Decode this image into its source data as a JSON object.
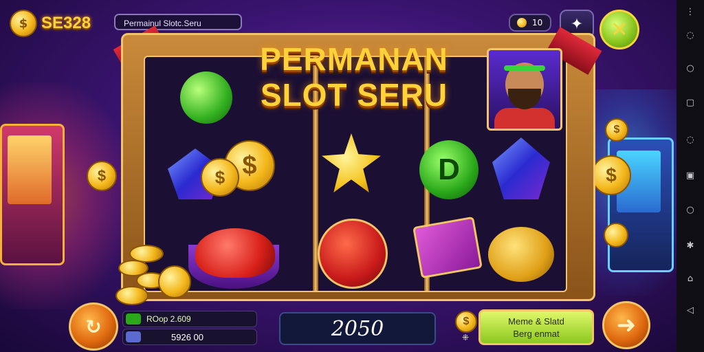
{
  "header": {
    "brand": "SE328",
    "search_value": "Permainul Slotc.Seru",
    "coin_count": "10"
  },
  "title": {
    "line1": "PERMANAN",
    "line2": "SLOT SERU"
  },
  "reels": {
    "coin_symbol": "$",
    "letter_symbol": "D"
  },
  "controls": {
    "info_top": "ROop 2.609",
    "info_bottom": "5926 00",
    "total": "2050",
    "action_line1": "Meme & Slatd",
    "action_line2": "Berg enmat"
  },
  "colors": {
    "gold": "#ffd23a",
    "green": "#8cc820",
    "orange": "#e06a10",
    "purple": "#3a1470"
  },
  "icons": {
    "close": "close-icon",
    "puzzle": "puzzle-icon",
    "spin": "refresh-icon",
    "next": "arrow-right-icon"
  }
}
